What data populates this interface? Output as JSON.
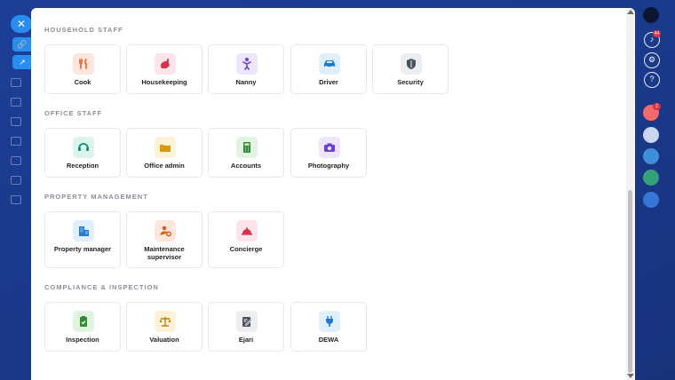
{
  "background": {
    "close_glyph": "✕",
    "side_tab_1_glyph": "🔗",
    "side_tab_2_glyph": "↗",
    "notifications_count": "44",
    "user_badge": "2"
  },
  "sections": [
    {
      "title": "HOUSEHOLD STAFF",
      "items": [
        {
          "label": "Cook",
          "icon": "cook-icon",
          "bg": "#fde7dc",
          "fg": "#e0622b"
        },
        {
          "label": "Housekeeping",
          "icon": "housekeeping-icon",
          "bg": "#fde4e8",
          "fg": "#d9304e"
        },
        {
          "label": "Nanny",
          "icon": "nanny-icon",
          "bg": "#ece5fb",
          "fg": "#6a3fd0"
        },
        {
          "label": "Driver",
          "icon": "driver-icon",
          "bg": "#dfeffc",
          "fg": "#1f7ad6"
        },
        {
          "label": "Security",
          "icon": "security-icon",
          "bg": "#eceef1",
          "fg": "#4a5260"
        }
      ]
    },
    {
      "title": "OFFICE STAFF",
      "items": [
        {
          "label": "Reception",
          "icon": "reception-icon",
          "bg": "#dcf4ee",
          "fg": "#128a6b"
        },
        {
          "label": "Office admin",
          "icon": "office-admin-icon",
          "bg": "#fdf1d8",
          "fg": "#d99a12"
        },
        {
          "label": "Accounts",
          "icon": "accounts-icon",
          "bg": "#e1f4e1",
          "fg": "#2e8c36"
        },
        {
          "label": "Photography",
          "icon": "photography-icon",
          "bg": "#ece5fb",
          "fg": "#6a3fd0"
        }
      ]
    },
    {
      "title": "PROPERTY MANAGEMENT",
      "items": [
        {
          "label": "Property manager",
          "icon": "property-manager-icon",
          "bg": "#dfeffc",
          "fg": "#1f7ad6"
        },
        {
          "label": "Maintenance supervisor",
          "icon": "maintenance-supervisor-icon",
          "bg": "#fde7dc",
          "fg": "#d9601f"
        },
        {
          "label": "Concierge",
          "icon": "concierge-icon",
          "bg": "#fde4e8",
          "fg": "#d9304e"
        }
      ]
    },
    {
      "title": "COMPLIANCE & INSPECTION",
      "items": [
        {
          "label": "Inspection",
          "icon": "inspection-icon",
          "bg": "#e1f4e1",
          "fg": "#2e8c36"
        },
        {
          "label": "Valuation",
          "icon": "valuation-icon",
          "bg": "#fdf1d8",
          "fg": "#b9840d"
        },
        {
          "label": "Ejari",
          "icon": "ejari-icon",
          "bg": "#eceef1",
          "fg": "#4a5260"
        },
        {
          "label": "DEWA",
          "icon": "dewa-icon",
          "bg": "#dfeffc",
          "fg": "#1f7ad6"
        }
      ]
    }
  ]
}
